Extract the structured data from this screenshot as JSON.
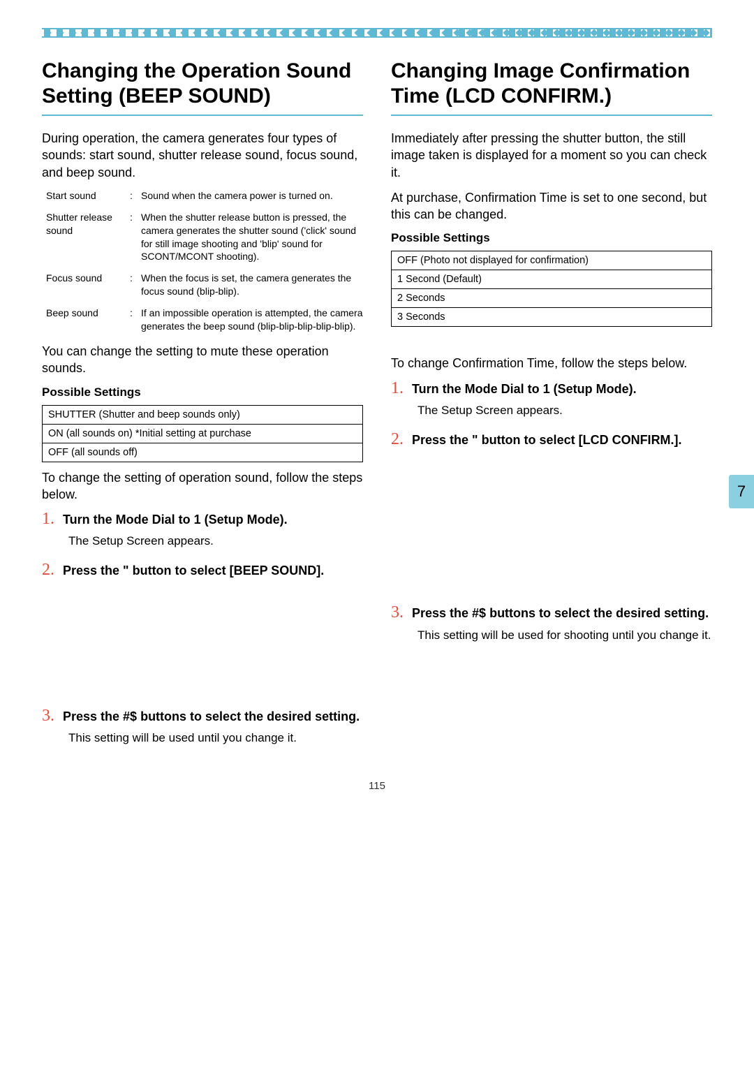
{
  "left": {
    "title": "Changing the Operation Sound Setting (BEEP SOUND)",
    "intro": "During operation, the camera generates four types of sounds: start sound, shutter release sound, focus sound, and beep sound.",
    "defs": [
      {
        "term": "Start sound",
        "desc": "Sound when the camera power is turned on."
      },
      {
        "term": "Shutter release sound",
        "desc": "When the shutter release button is pressed, the camera generates the shutter sound ('click' sound for still image shooting and 'blip' sound for SCONT/MCONT shooting)."
      },
      {
        "term": "Focus sound",
        "desc": "When the focus is set, the camera generates the focus sound (blip-blip)."
      },
      {
        "term": "Beep sound",
        "desc": "If an impossible operation is attempted, the camera generates the beep sound (blip-blip-blip-blip-blip)."
      }
    ],
    "after_defs": "You can change the setting to mute these operation sounds.",
    "possible_heading": "Possible Settings",
    "settings": [
      "SHUTTER (Shutter and beep sounds only)",
      "ON (all sounds on) *Initial setting at purchase",
      "OFF (all sounds off)"
    ],
    "after_settings": "To change the setting of operation sound, follow the steps below.",
    "steps": [
      {
        "num": "1.",
        "title": "Turn the Mode Dial to 1 (Setup Mode).",
        "desc": "The Setup Screen appears."
      },
      {
        "num": "2.",
        "title": "Press the \"  button to select [BEEP SOUND].",
        "desc": ""
      },
      {
        "num": "3.",
        "title": "Press the #$  buttons to select the desired setting.",
        "desc": "This setting will be used until you change it."
      }
    ]
  },
  "right": {
    "title": "Changing Image Confirmation Time (LCD CONFIRM.)",
    "intro1": "Immediately after pressing the shutter button, the still image taken is displayed for a moment so you can check it.",
    "intro2": "At purchase, Confirmation Time is set to one second, but this can be changed.",
    "possible_heading": "Possible Settings",
    "settings": [
      "OFF (Photo not displayed for confirmation)",
      "1 Second (Default)",
      "2 Seconds",
      "3 Seconds"
    ],
    "after_settings": "To change Confirmation Time, follow the steps below.",
    "steps": [
      {
        "num": "1.",
        "title": "Turn the Mode Dial to 1 (Setup Mode).",
        "desc": "The Setup Screen appears."
      },
      {
        "num": "2.",
        "title": "Press the \"  button to select [LCD CONFIRM.].",
        "desc": ""
      },
      {
        "num": "3.",
        "title": "Press the #$  buttons to select the desired setting.",
        "desc": "This setting will be used for shooting until you change it."
      }
    ]
  },
  "side_tab": "7",
  "page_number": "115"
}
